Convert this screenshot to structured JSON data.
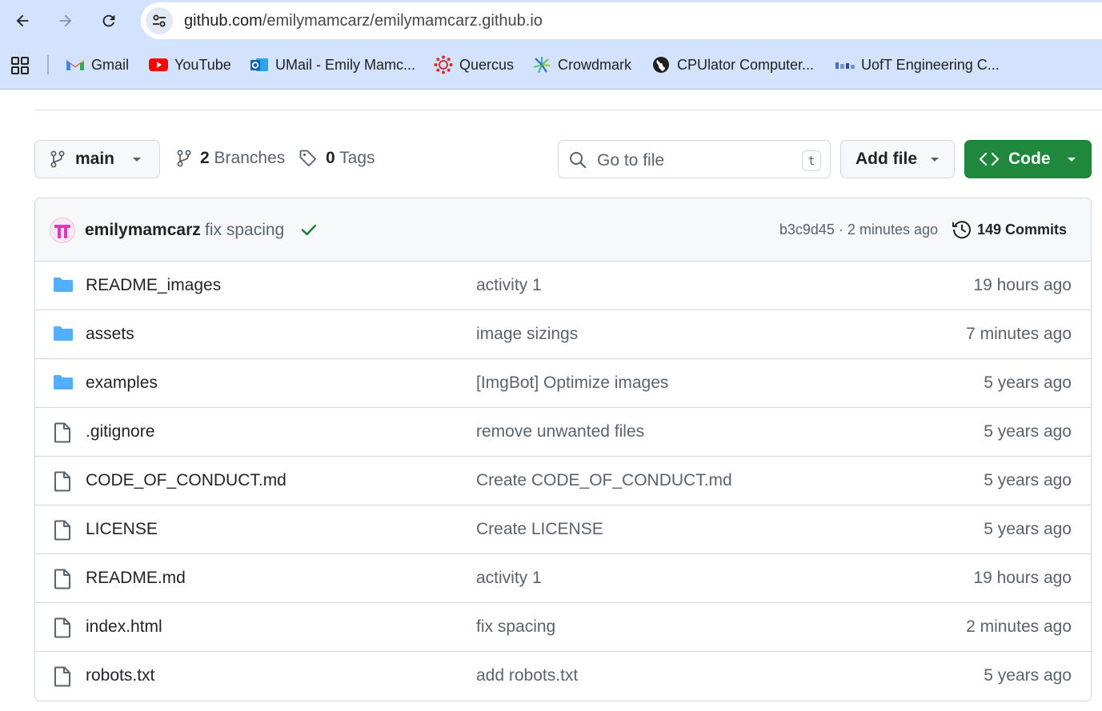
{
  "browser": {
    "url_host": "github.com",
    "url_path": "/emilymamcarz/emilymamcarz.github.io",
    "bookmarks": [
      {
        "label": "Gmail",
        "icon": "gmail-icon"
      },
      {
        "label": "YouTube",
        "icon": "youtube-icon"
      },
      {
        "label": "UMail - Emily Mamc...",
        "icon": "outlook-icon"
      },
      {
        "label": "Quercus",
        "icon": "quercus-icon"
      },
      {
        "label": "Crowdmark",
        "icon": "crowdmark-icon"
      },
      {
        "label": "CPUlator Computer...",
        "icon": "globe-icon"
      },
      {
        "label": "UofT Engineering C...",
        "icon": "uoft-engineering-icon"
      }
    ]
  },
  "repo": {
    "branch": "main",
    "branches_count": "2",
    "branches_label": "Branches",
    "tags_count": "0",
    "tags_label": "Tags",
    "goto_placeholder": "Go to file",
    "goto_shortcut": "t",
    "add_file_label": "Add file",
    "code_label": "Code"
  },
  "last_commit": {
    "author": "emilymamcarz",
    "message": "fix spacing",
    "hash_time": "b3c9d45 · 2 minutes ago",
    "commits_label": "149 Commits"
  },
  "files": [
    {
      "name": "README_images",
      "type": "folder",
      "message": "activity 1",
      "time": "19 hours ago"
    },
    {
      "name": "assets",
      "type": "folder",
      "message": "image sizings",
      "time": "7 minutes ago"
    },
    {
      "name": "examples",
      "type": "folder",
      "message": "[ImgBot] Optimize images",
      "time": "5 years ago"
    },
    {
      "name": ".gitignore",
      "type": "file",
      "message": "remove unwanted files",
      "time": "5 years ago"
    },
    {
      "name": "CODE_OF_CONDUCT.md",
      "type": "file",
      "message": "Create CODE_OF_CONDUCT.md",
      "time": "5 years ago"
    },
    {
      "name": "LICENSE",
      "type": "file",
      "message": "Create LICENSE",
      "time": "5 years ago"
    },
    {
      "name": "README.md",
      "type": "file",
      "message": "activity 1",
      "time": "19 hours ago"
    },
    {
      "name": "index.html",
      "type": "file",
      "message": "fix spacing",
      "time": "2 minutes ago"
    },
    {
      "name": "robots.txt",
      "type": "file",
      "message": "add robots.txt",
      "time": "5 years ago"
    }
  ],
  "colors": {
    "browser_chrome": "#d3e3fd",
    "folder": "#54aeff",
    "code_button": "#1f883d",
    "check": "#1a7f37"
  }
}
